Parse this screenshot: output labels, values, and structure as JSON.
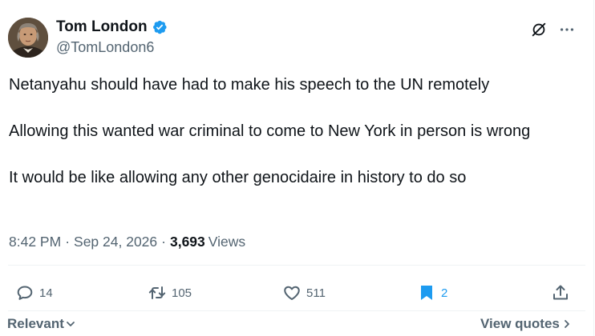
{
  "author": {
    "display_name": "Tom London",
    "handle": "@TomLondon6",
    "verified": true
  },
  "tweet": {
    "paragraphs": [
      "Netanyahu should have had to make his speech to the UN remotely",
      "Allowing this wanted war criminal to come to New York in person is wrong",
      "It would be like allowing any other genocidaire in history to do so"
    ]
  },
  "meta": {
    "time": "8:42 PM",
    "separator": "·",
    "date": "Sep 24, 2026",
    "views_count": "3,693",
    "views_label": "Views"
  },
  "actions": {
    "replies": "14",
    "reposts": "105",
    "likes": "511",
    "bookmarks": "2"
  },
  "footer": {
    "sort_label": "Relevant",
    "view_quotes_label": "View quotes"
  },
  "colors": {
    "accent": "#1d9bf0",
    "text_primary": "#0f1419",
    "text_secondary": "#536471",
    "divider": "#eff3f4"
  },
  "icons": {
    "verified": "verified-badge-icon",
    "grok": "grok-icon",
    "more": "more-icon",
    "reply": "reply-icon",
    "repost": "repost-icon",
    "like": "heart-icon",
    "bookmark": "bookmark-icon",
    "share": "share-icon"
  }
}
